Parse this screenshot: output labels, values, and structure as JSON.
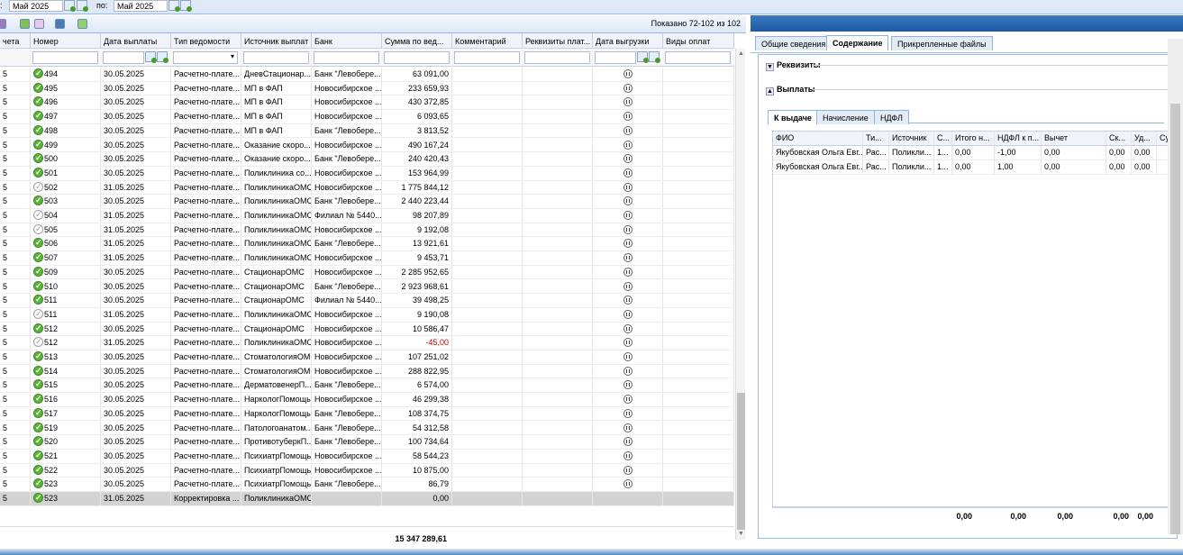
{
  "filter_bar": {
    "date_from": "Май 2025",
    "to_label": "по:",
    "date_to": "Май 2025",
    "prefix": ":"
  },
  "grid": {
    "shown_text": "Показано 72-102 из 102",
    "columns": [
      "чета",
      "Номер",
      "Дата выплаты",
      "Тип ведомости",
      "Источник выплат",
      "Банк",
      "Сумма по вед...",
      "Комментарий",
      "Реквизиты плат...",
      "Дата выгрузки",
      "Виды оплат"
    ],
    "rows": [
      [
        "5",
        "ok",
        "494",
        "30.05.2025",
        "Расчетно-плате...",
        "ДневСтационар...",
        "Банк \"Левобере...",
        "63 091,00"
      ],
      [
        "5",
        "ok",
        "495",
        "30.05.2025",
        "Расчетно-плате...",
        "МП в ФАП",
        "Новосибирское ...",
        "233 659,93"
      ],
      [
        "5",
        "ok",
        "496",
        "30.05.2025",
        "Расчетно-плате...",
        "МП в ФАП",
        "Новосибирское ...",
        "430 372,85"
      ],
      [
        "5",
        "ok",
        "497",
        "30.05.2025",
        "Расчетно-плате...",
        "МП в ФАП",
        "Новосибирское ...",
        "6 093,65"
      ],
      [
        "5",
        "ok",
        "498",
        "30.05.2025",
        "Расчетно-плате...",
        "МП в ФАП",
        "Банк \"Левобере...",
        "3 813,52"
      ],
      [
        "5",
        "ok",
        "499",
        "30.05.2025",
        "Расчетно-плате...",
        "Оказание скоро...",
        "Новосибирское ...",
        "490 167,24"
      ],
      [
        "5",
        "ok",
        "500",
        "30.05.2025",
        "Расчетно-плате...",
        "Оказание скоро...",
        "Банк \"Левобере...",
        "240 420,43"
      ],
      [
        "5",
        "ok",
        "501",
        "30.05.2025",
        "Расчетно-плате...",
        "Поликлиника со...",
        "Новосибирское ...",
        "153 964,99"
      ],
      [
        "5",
        "pend",
        "502",
        "31.05.2025",
        "Расчетно-плате...",
        "ПоликлиникаОМС",
        "Новосибирское ...",
        "1 775 844,12"
      ],
      [
        "5",
        "ok",
        "503",
        "30.05.2025",
        "Расчетно-плате...",
        "ПоликлиникаОМС",
        "Банк \"Левобере...",
        "2 440 223,44"
      ],
      [
        "5",
        "pend",
        "504",
        "31.05.2025",
        "Расчетно-плате...",
        "ПоликлиникаОМС",
        "Филиал № 5440...",
        "98 207,89"
      ],
      [
        "5",
        "pend",
        "505",
        "31.05.2025",
        "Расчетно-плате...",
        "ПоликлиникаОМС",
        "Новосибирское ...",
        "9 192,08"
      ],
      [
        "5",
        "ok",
        "506",
        "31.05.2025",
        "Расчетно-плате...",
        "ПоликлиникаОМС",
        "Банк \"Левобере...",
        "13 921,61"
      ],
      [
        "5",
        "ok",
        "507",
        "31.05.2025",
        "Расчетно-плате...",
        "ПоликлиникаОМС",
        "Новосибирское ...",
        "9 453,71"
      ],
      [
        "5",
        "ok",
        "509",
        "30.05.2025",
        "Расчетно-плате...",
        "СтационарОМС",
        "Новосибирское ...",
        "2 285 952,65"
      ],
      [
        "5",
        "ok",
        "510",
        "30.05.2025",
        "Расчетно-плате...",
        "СтационарОМС",
        "Банк \"Левобере...",
        "2 923 968,61"
      ],
      [
        "5",
        "ok",
        "511",
        "30.05.2025",
        "Расчетно-плате...",
        "СтационарОМС",
        "Филиал № 5440...",
        "39 498,25"
      ],
      [
        "5",
        "pend",
        "511",
        "31.05.2025",
        "Расчетно-плате...",
        "ПоликлиникаОМС",
        "Новосибирское ...",
        "9 190,08"
      ],
      [
        "5",
        "ok",
        "512",
        "30.05.2025",
        "Расчетно-плате...",
        "СтационарОМС",
        "Новосибирское ...",
        "10 586,47"
      ],
      [
        "5",
        "pend",
        "512",
        "31.05.2025",
        "Расчетно-плате...",
        "ПоликлиникаОМС",
        "Новосибирское ...",
        "-45,00"
      ],
      [
        "5",
        "ok",
        "513",
        "30.05.2025",
        "Расчетно-плате...",
        "СтоматологияОМС",
        "Новосибирское ...",
        "107 251,02"
      ],
      [
        "5",
        "ok",
        "514",
        "30.05.2025",
        "Расчетно-плате...",
        "СтоматологияОМС",
        "Новосибирское ...",
        "288 822,95"
      ],
      [
        "5",
        "ok",
        "515",
        "30.05.2025",
        "Расчетно-плате...",
        "ДерматовенерП...",
        "Банк \"Левобере...",
        "6 574,00"
      ],
      [
        "5",
        "ok",
        "516",
        "30.05.2025",
        "Расчетно-плате...",
        "НаркологПомощь",
        "Новосибирское ...",
        "46 299,38"
      ],
      [
        "5",
        "ok",
        "517",
        "30.05.2025",
        "Расчетно-плате...",
        "НаркологПомощь",
        "Банк \"Левобере...",
        "108 374,75"
      ],
      [
        "5",
        "ok",
        "519",
        "30.05.2025",
        "Расчетно-плате...",
        "Патологоанатом...",
        "Банк \"Левобере...",
        "54 312,58"
      ],
      [
        "5",
        "ok",
        "520",
        "30.05.2025",
        "Расчетно-плате...",
        "ПротивотуберкП...",
        "Банк \"Левобере...",
        "100 734,64"
      ],
      [
        "5",
        "ok",
        "521",
        "30.05.2025",
        "Расчетно-плате...",
        "ПсихиатрПомощь",
        "Новосибирское ...",
        "58 544,23"
      ],
      [
        "5",
        "ok",
        "522",
        "30.05.2025",
        "Расчетно-плате...",
        "ПсихиатрПомощь",
        "Новосибирское ...",
        "10 875,00"
      ],
      [
        "5",
        "ok",
        "523",
        "30.05.2025",
        "Расчетно-плате...",
        "ПсихиатрПомощь",
        "Банк \"Левобере...",
        "86,79"
      ],
      [
        "5",
        "ok",
        "523",
        "31.05.2025",
        "Корректировка ...",
        "ПоликлиникаОМС",
        "",
        "0,00"
      ]
    ],
    "total": "15 347 289,61"
  },
  "right": {
    "tabs": [
      "Общие сведения",
      "Содержание",
      "Прикрепленные файлы"
    ],
    "sections": [
      "Реквизиты",
      "Выплаты"
    ],
    "inner_tabs": [
      "К выдаче",
      "Начисление",
      "НДФЛ"
    ],
    "inner_columns": [
      "ФИО",
      "Ти...",
      "Источник",
      "С...",
      "Итого н...",
      "НДФЛ к п...",
      "Вычет",
      "Ск...",
      "Уд...",
      "Сум"
    ],
    "inner_rows": [
      [
        "Якубовская Ольга Евг...",
        "Рас...",
        "Поликли...",
        "1...",
        "0,00",
        "-1,00",
        "0,00",
        "0,00",
        "0,00"
      ],
      [
        "Якубовская Ольга Евг...",
        "Рас...",
        "Поликли...",
        "1...",
        "0,00",
        "1,00",
        "0,00",
        "0,00",
        "0,00"
      ]
    ],
    "inner_totals": [
      "0,00",
      "0,00",
      "0,00",
      "0,00",
      "0,00"
    ]
  }
}
